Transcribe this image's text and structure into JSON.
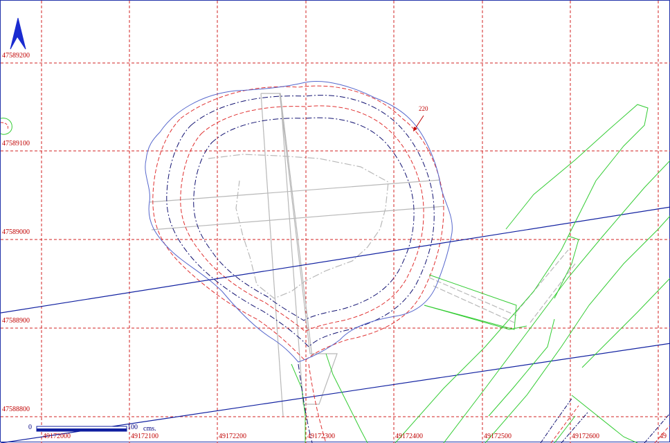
{
  "map": {
    "north_arrow": "north-arrow-icon",
    "y_grid_labels": [
      "47589200",
      "47589100",
      "47589000",
      "47588900",
      "47588800"
    ],
    "x_grid_labels": [
      "49172000",
      "49172100",
      "49172200",
      "49172300",
      "49172400",
      "49172500",
      "49172600",
      "49"
    ],
    "annotation": "220",
    "scale_bar": {
      "start": "0",
      "end": "100",
      "unit": "cms."
    },
    "colors": {
      "grid": "#d02020",
      "boundary": "#5566cc",
      "road": "#1020a0",
      "parcels": "#33cc33",
      "contour_red": "#e03030",
      "contour_blue": "#101070",
      "paths": "#b0b0b0"
    }
  }
}
